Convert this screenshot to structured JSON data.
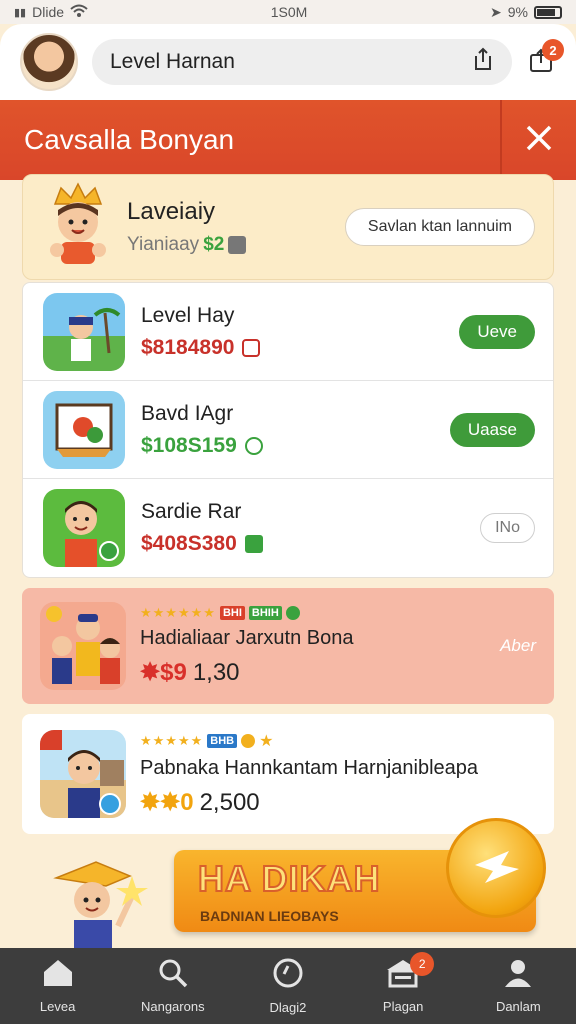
{
  "status_bar": {
    "carrier": "Dlide",
    "time": "1S0M",
    "battery_text": "9%"
  },
  "header": {
    "search_text": "Level Harnan",
    "cart_badge": "2"
  },
  "banner": {
    "title": "Cavsalla Bonyan"
  },
  "user_card": {
    "name": "Laveiaiy",
    "sub_label": "Yianiaay",
    "amount": "$2",
    "button_label": "Savlan ktan lannuim"
  },
  "list": [
    {
      "title": "Level Hay",
      "price": "$8184890",
      "price_color": "#c8312a",
      "button": "Ueve",
      "button_style": "green"
    },
    {
      "title": "Bavd IAgr",
      "price": "$108S159",
      "price_color": "#3aa23e",
      "button": "Uaase",
      "button_style": "green"
    },
    {
      "title": "Sardie Rar",
      "price": "$408S380",
      "price_color": "#c8312a",
      "button": "INo",
      "button_style": "ghost"
    }
  ],
  "promo1": {
    "stars": "★★★★★★",
    "tag1": "BHI",
    "tag2": "BHIH",
    "title": "Hadialiaar Jarxutn Bona",
    "value_prefix": "✸$9",
    "value": "1,30",
    "side_label": "Aber"
  },
  "promo2": {
    "stars": "★★★★★",
    "tag1": "BHB",
    "title": "Pabnaka Hannkantam Harnjanibleapa",
    "value_prefix": "✸✸0",
    "value": "2,500"
  },
  "hero": {
    "title": "HA DIKAH",
    "subtitle": "BADNIAN LIEOBAYS"
  },
  "nav": [
    {
      "label": "Levea",
      "icon": "home-icon"
    },
    {
      "label": "Nangarons",
      "icon": "search-icon"
    },
    {
      "label": "Dlagi2",
      "icon": "clock-icon"
    },
    {
      "label": "Plagan",
      "icon": "store-icon",
      "badge": "2"
    },
    {
      "label": "Danlam",
      "icon": "user-icon"
    }
  ],
  "colors": {
    "accent": "#e0542b",
    "green": "#3f9b3a",
    "nav_bg": "#3d3d3d"
  }
}
